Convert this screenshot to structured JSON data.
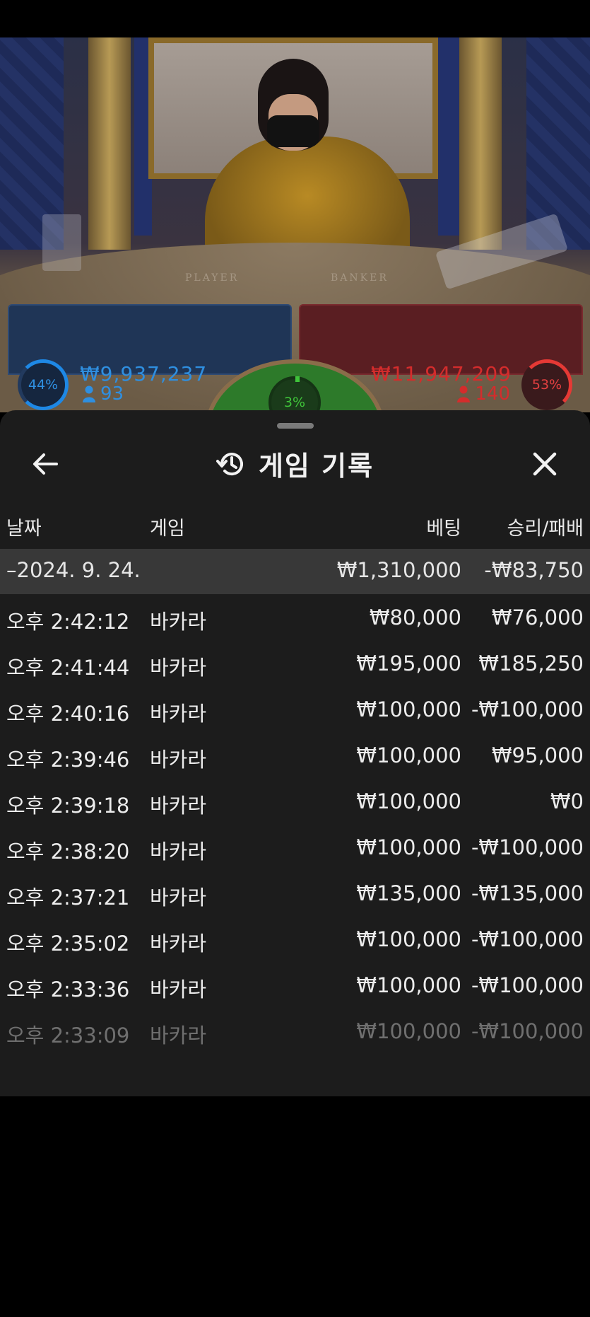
{
  "video": {
    "table_labels": {
      "player": "PLAYER",
      "banker": "BANKER"
    },
    "player": {
      "percent": "44%",
      "amount": "₩9,937,237",
      "count": "93"
    },
    "tie": {
      "percent": "3%"
    },
    "banker": {
      "percent": "53%",
      "amount": "₩11,947,209",
      "count": "140"
    },
    "colors": {
      "player": "#2f8fe0",
      "banker": "#d42c2c",
      "tie": "#3fc43a"
    }
  },
  "sheet": {
    "title": "게임 기록",
    "icons": {
      "back": "arrow-left-icon",
      "history": "history-icon",
      "close": "close-icon"
    },
    "columns": {
      "date": "날짜",
      "game": "게임",
      "bet": "베팅",
      "result": "승리/패배"
    },
    "group": {
      "date": "–2024. 9. 24.",
      "bet": "₩1,310,000",
      "result": "-₩83,750"
    },
    "rows": [
      {
        "time": "오후 2:42:12",
        "game": "바카라",
        "bet": "₩80,000",
        "result": "₩76,000"
      },
      {
        "time": "오후 2:41:44",
        "game": "바카라",
        "bet": "₩195,000",
        "result": "₩185,250"
      },
      {
        "time": "오후 2:40:16",
        "game": "바카라",
        "bet": "₩100,000",
        "result": "-₩100,000"
      },
      {
        "time": "오후 2:39:46",
        "game": "바카라",
        "bet": "₩100,000",
        "result": "₩95,000"
      },
      {
        "time": "오후 2:39:18",
        "game": "바카라",
        "bet": "₩100,000",
        "result": "₩0"
      },
      {
        "time": "오후 2:38:20",
        "game": "바카라",
        "bet": "₩100,000",
        "result": "-₩100,000"
      },
      {
        "time": "오후 2:37:21",
        "game": "바카라",
        "bet": "₩135,000",
        "result": "-₩135,000"
      },
      {
        "time": "오후 2:35:02",
        "game": "바카라",
        "bet": "₩100,000",
        "result": "-₩100,000"
      },
      {
        "time": "오후 2:33:36",
        "game": "바카라",
        "bet": "₩100,000",
        "result": "-₩100,000"
      },
      {
        "time": "오후 2:33:09",
        "game": "바카라",
        "bet": "₩100,000",
        "result": "-₩100,000"
      }
    ]
  }
}
